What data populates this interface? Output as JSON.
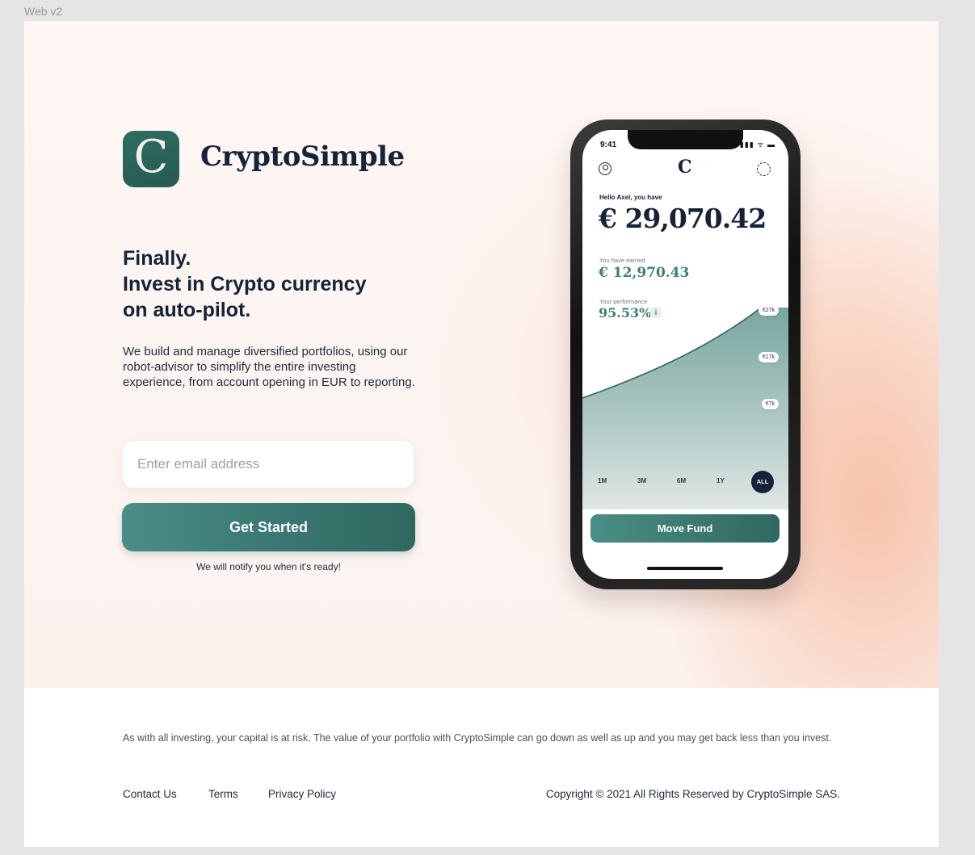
{
  "frame_label": "Web v2",
  "brand": {
    "logo_letter": "C",
    "name": "CryptoSimple"
  },
  "hero": {
    "headline": [
      "Finally.",
      "Invest in Crypto currency",
      "on auto-pilot."
    ],
    "description": "We build and manage diversified portfolios, using our robot-advisor to simplify the entire investing experience, from account opening in EUR to reporting.",
    "email_placeholder": "Enter email address",
    "cta_label": "Get Started",
    "notify_text": "We will notify you when it's ready!"
  },
  "phone": {
    "time": "9:41",
    "status_icons": "▮▮▮ ᯤ ▬",
    "logo_letter": "C",
    "greeting": "Hello Axel, you have",
    "balance": "€ 29,070.42",
    "earned_label": "You have earned",
    "earned": "€ 12,970.43",
    "performance_label": "Your performance",
    "performance": "95.53%",
    "info_icon": "i",
    "chart_chips": [
      "€27k",
      "€17k",
      "€7k"
    ],
    "ranges": [
      "1M",
      "3M",
      "6M",
      "1Y",
      "ALL"
    ],
    "move_fund_label": "Move Fund"
  },
  "footer": {
    "disclaimer": "As with all investing, your capital is at risk. The value of your portfolio with CryptoSimple can go down as well as up and you may get back less than you invest.",
    "links": [
      "Contact Us",
      "Terms",
      "Privacy Policy"
    ],
    "copyright": "Copyright © 2021 All Rights Reserved by CryptoSimple SAS."
  },
  "colors": {
    "brand_green": "#2f6d63",
    "navy": "#152238",
    "hero_bg": "#fdf6f3",
    "accent_peach": "#f5b496"
  },
  "icons": [
    "user-icon",
    "settings-icon",
    "info-icon"
  ]
}
